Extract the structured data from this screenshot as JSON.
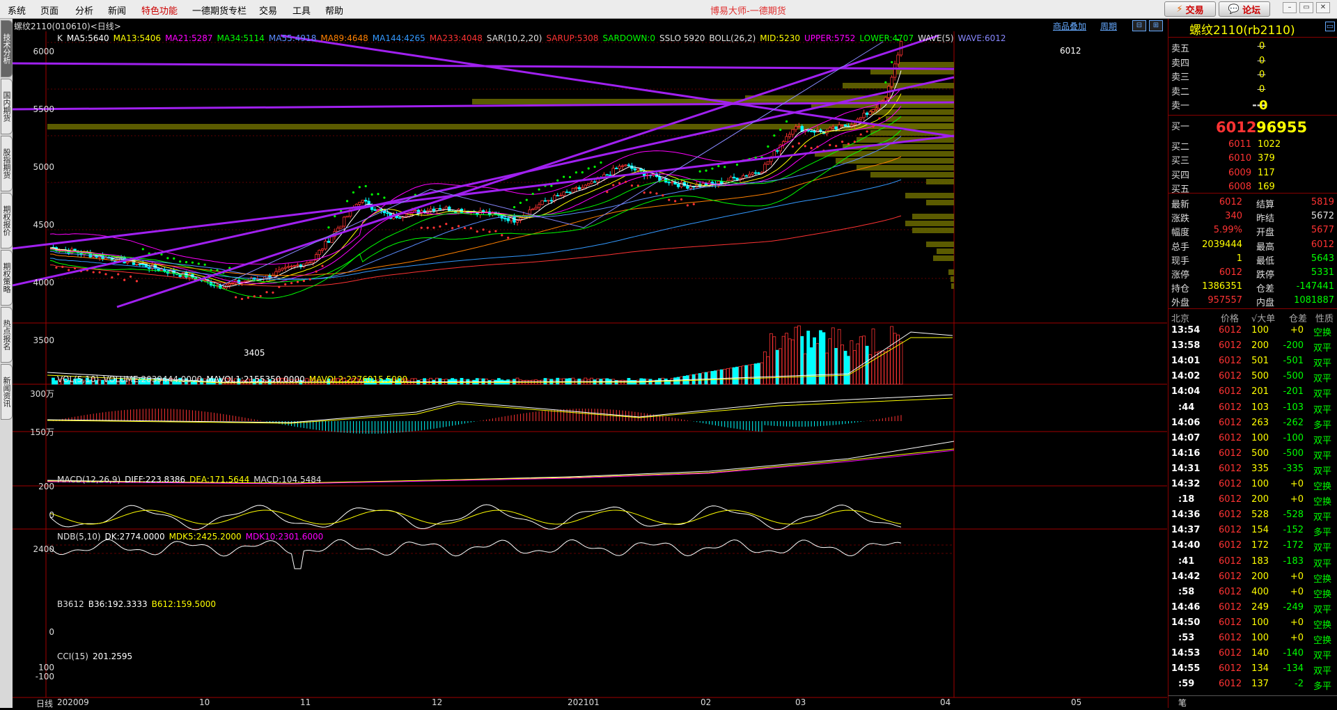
{
  "menu": {
    "items": [
      "系统",
      "页面",
      "分析",
      "新闻",
      "特色功能",
      "一德期货专栏",
      "交易",
      "工具",
      "帮助"
    ],
    "app_title": "博易大师-一德期货",
    "trade_btn": "交易",
    "forum_btn": "论坛",
    "trade_icon": "lightning-icon",
    "forum_icon": "chat-bubble-icon"
  },
  "sidebar": {
    "tabs": [
      "技术分析",
      "国内期货",
      "股指期货",
      "期权报价",
      "期权策略",
      "热点报名",
      "新闻资讯"
    ]
  },
  "chart_header": {
    "instrument": "螺纹2110(010610)<日线>",
    "product_overlay": "商品叠加",
    "period": "周期"
  },
  "main_indicators": [
    {
      "text": "K",
      "color": "#e0e0e0"
    },
    {
      "text": "MA5:5640",
      "color": "#ffffff"
    },
    {
      "text": "MA13:5406",
      "color": "#ffff00"
    },
    {
      "text": "MA21:5287",
      "color": "#ff00ff"
    },
    {
      "text": "MA34:5114",
      "color": "#00ff00"
    },
    {
      "text": "MA55:4918",
      "color": "#5b8cff"
    },
    {
      "text": "MA89:4648",
      "color": "#ff8000"
    },
    {
      "text": "MA144:4265",
      "color": "#3399ff"
    },
    {
      "text": "MA233:4048",
      "color": "#ff3333"
    },
    {
      "text": "SAR(10,2,20)",
      "color": "#e0e0e0"
    },
    {
      "text": "SARUP:5308",
      "color": "#ff3333"
    },
    {
      "text": "SARDOWN:0",
      "color": "#00ff00"
    },
    {
      "text": "SSLO 5920",
      "color": "#e0e0e0"
    },
    {
      "text": "BOLL(26,2)",
      "color": "#e0e0e0"
    },
    {
      "text": "MID:5230",
      "color": "#ffff00"
    },
    {
      "text": "UPPER:5752",
      "color": "#ff00ff"
    },
    {
      "text": "LOWER:4707",
      "color": "#00ff00"
    },
    {
      "text": "WAVE(5)",
      "color": "#e0e0e0"
    },
    {
      "text": "WAVE:6012",
      "color": "#8888ff"
    }
  ],
  "vol_indicators": [
    {
      "text": "VOL(5,10)",
      "color": "#e0e0e0"
    },
    {
      "text": "VOLUME:2039444.0000",
      "color": "#e0e0e0"
    },
    {
      "text": "MAVOL1:2155350.0000",
      "color": "#ffffff"
    },
    {
      "text": "MAVOL2:2276015.5000",
      "color": "#ffff00"
    }
  ],
  "macd_indicators": [
    {
      "text": "MACD(12,26,9)",
      "color": "#e0e0e0"
    },
    {
      "text": "DIFF:223.8386",
      "color": "#ffffff"
    },
    {
      "text": "DEA:171.5644",
      "color": "#ffff00"
    },
    {
      "text": "MACD:104.5484",
      "color": "#e0e0e0"
    }
  ],
  "ndb_indicators": [
    {
      "text": "NDB(5,10)",
      "color": "#e0e0e0"
    },
    {
      "text": "DK:2774.0000",
      "color": "#ffffff"
    },
    {
      "text": "MDK5:2425.2000",
      "color": "#ffff00"
    },
    {
      "text": "MDK10:2301.6000",
      "color": "#ff00ff"
    }
  ],
  "b36_indicators": [
    {
      "text": "B3612",
      "color": "#e0e0e0"
    },
    {
      "text": "B36:192.3333",
      "color": "#ffffff"
    },
    {
      "text": "B612:159.5000",
      "color": "#ffff00"
    }
  ],
  "cci_indicators": [
    {
      "text": "CCI(15)",
      "color": "#e0e0e0"
    },
    {
      "text": "201.2595",
      "color": "#ffffff"
    }
  ],
  "axis": {
    "price_ticks": [
      "6000",
      "5500",
      "5000",
      "4500",
      "4000",
      "3500"
    ],
    "vol_ticks": [
      "300万",
      "150万"
    ],
    "macd_ticks": [
      "200",
      "0"
    ],
    "ndb_ticks": [
      "2400"
    ],
    "b36_ticks": [
      "0"
    ],
    "cci_ticks": [
      "100",
      "-100"
    ],
    "x_label": "日线",
    "x_ticks": [
      "202009",
      "10",
      "11",
      "12",
      "202101",
      "02",
      "03",
      "04",
      "05"
    ],
    "high_marker": "6012",
    "low_marker": "3405"
  },
  "quote": {
    "title": "螺纹2110(rb2110)",
    "asks": [
      {
        "label": "卖五",
        "price": "—",
        "vol": "0"
      },
      {
        "label": "卖四",
        "price": "—",
        "vol": "0"
      },
      {
        "label": "卖三",
        "price": "—",
        "vol": "0"
      },
      {
        "label": "卖二",
        "price": "—",
        "vol": "0"
      },
      {
        "label": "卖一",
        "price": "---",
        "vol": "0"
      }
    ],
    "bids": [
      {
        "label": "买一",
        "price": "6012",
        "vol": "96955"
      },
      {
        "label": "买二",
        "price": "6011",
        "vol": "1022"
      },
      {
        "label": "买三",
        "price": "6010",
        "vol": "379"
      },
      {
        "label": "买四",
        "price": "6009",
        "vol": "117"
      },
      {
        "label": "买五",
        "price": "6008",
        "vol": "169"
      }
    ],
    "stats": [
      {
        "l1": "最新",
        "v1": "6012",
        "c1": "#ff3333",
        "l2": "结算",
        "v2": "5819",
        "c2": "#ff3333"
      },
      {
        "l1": "涨跌",
        "v1": "340",
        "c1": "#ff3333",
        "l2": "昨结",
        "v2": "5672",
        "c2": "#e0e0e0"
      },
      {
        "l1": "幅度",
        "v1": "5.99%",
        "c1": "#ff3333",
        "l2": "开盘",
        "v2": "5677",
        "c2": "#ff3333"
      },
      {
        "l1": "总手",
        "v1": "2039444",
        "c1": "#ffff00",
        "l2": "最高",
        "v2": "6012",
        "c2": "#ff3333"
      },
      {
        "l1": "现手",
        "v1": "1",
        "c1": "#ffff00",
        "l2": "最低",
        "v2": "5643",
        "c2": "#00ff00"
      },
      {
        "l1": "涨停",
        "v1": "6012",
        "c1": "#ff3333",
        "l2": "跌停",
        "v2": "5331",
        "c2": "#00ff00"
      },
      {
        "l1": "持仓",
        "v1": "1386351",
        "c1": "#ffff00",
        "l2": "仓差",
        "v2": "-147441",
        "c2": "#00ff00"
      },
      {
        "l1": "外盘",
        "v1": "957557",
        "c1": "#ff3333",
        "l2": "内盘",
        "v2": "1081887",
        "c2": "#00ff00"
      }
    ],
    "ticks_header": {
      "loc": "北京",
      "price": "价格",
      "big": "√大单",
      "diff": "仓差",
      "nature": "性质"
    },
    "ticks": [
      {
        "time": "13:54",
        "price": "6012",
        "vol": "100",
        "diff": "+0",
        "nature": "空换"
      },
      {
        "time": "13:58",
        "price": "6012",
        "vol": "200",
        "diff": "-200",
        "nature": "双平"
      },
      {
        "time": "14:01",
        "price": "6012",
        "vol": "501",
        "diff": "-501",
        "nature": "双平"
      },
      {
        "time": "14:02",
        "price": "6012",
        "vol": "500",
        "diff": "-500",
        "nature": "双平"
      },
      {
        "time": "14:04",
        "price": "6012",
        "vol": "201",
        "diff": "-201",
        "nature": "双平"
      },
      {
        "time": ":44",
        "price": "6012",
        "vol": "103",
        "diff": "-103",
        "nature": "双平"
      },
      {
        "time": "14:06",
        "price": "6012",
        "vol": "263",
        "diff": "-262",
        "nature": "多平"
      },
      {
        "time": "14:07",
        "price": "6012",
        "vol": "100",
        "diff": "-100",
        "nature": "双平"
      },
      {
        "time": "14:16",
        "price": "6012",
        "vol": "500",
        "diff": "-500",
        "nature": "双平"
      },
      {
        "time": "14:31",
        "price": "6012",
        "vol": "335",
        "diff": "-335",
        "nature": "双平"
      },
      {
        "time": "14:32",
        "price": "6012",
        "vol": "100",
        "diff": "+0",
        "nature": "空换"
      },
      {
        "time": ":18",
        "price": "6012",
        "vol": "200",
        "diff": "+0",
        "nature": "空换"
      },
      {
        "time": "14:36",
        "price": "6012",
        "vol": "528",
        "diff": "-528",
        "nature": "双平"
      },
      {
        "time": "14:37",
        "price": "6012",
        "vol": "154",
        "diff": "-152",
        "nature": "多平"
      },
      {
        "time": "14:40",
        "price": "6012",
        "vol": "172",
        "diff": "-172",
        "nature": "双平"
      },
      {
        "time": ":41",
        "price": "6012",
        "vol": "183",
        "diff": "-183",
        "nature": "双平"
      },
      {
        "time": "14:42",
        "price": "6012",
        "vol": "200",
        "diff": "+0",
        "nature": "空换"
      },
      {
        "time": ":58",
        "price": "6012",
        "vol": "400",
        "diff": "+0",
        "nature": "空换"
      },
      {
        "time": "14:46",
        "price": "6012",
        "vol": "249",
        "diff": "-249",
        "nature": "双平"
      },
      {
        "time": "14:50",
        "price": "6012",
        "vol": "100",
        "diff": "+0",
        "nature": "空换"
      },
      {
        "time": ":53",
        "price": "6012",
        "vol": "100",
        "diff": "+0",
        "nature": "空换"
      },
      {
        "time": "14:53",
        "price": "6012",
        "vol": "140",
        "diff": "-140",
        "nature": "双平"
      },
      {
        "time": "14:55",
        "price": "6012",
        "vol": "134",
        "diff": "-134",
        "nature": "双平"
      },
      {
        "time": ":59",
        "price": "6012",
        "vol": "137",
        "diff": "-2",
        "nature": "多平"
      }
    ],
    "footer_label": "笔"
  },
  "colors": {
    "up": "#ff3333",
    "down": "#00ffff",
    "yellow": "#ffff00",
    "purple": "#a020f0",
    "olive": "#6b6b00",
    "grid": "#800000"
  }
}
